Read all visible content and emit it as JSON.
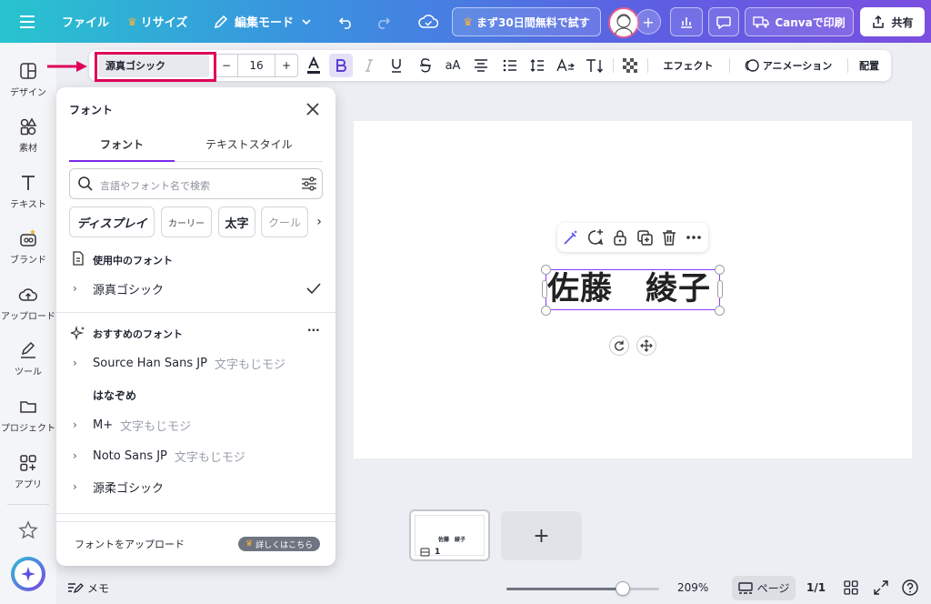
{
  "topbar": {
    "file_label": "ファイル",
    "resize_label": "リサイズ",
    "edit_mode_label": "編集モード",
    "trial_label": "まず30日間無料で試す",
    "print_label": "Canvaで印刷",
    "share_label": "共有"
  },
  "rail": {
    "items": [
      {
        "label": "デザイン",
        "icon": "layout-icon"
      },
      {
        "label": "素材",
        "icon": "shapes-icon"
      },
      {
        "label": "テキスト",
        "icon": "text-icon"
      },
      {
        "label": "ブランド",
        "icon": "brand-icon"
      },
      {
        "label": "アップロード",
        "icon": "cloud-upload-icon"
      },
      {
        "label": "ツール",
        "icon": "pen-icon"
      },
      {
        "label": "プロジェクト",
        "icon": "folder-icon"
      },
      {
        "label": "アプリ",
        "icon": "apps-icon"
      }
    ]
  },
  "toolbar": {
    "font_name": "源真ゴシック",
    "font_size": "16",
    "minus": "−",
    "plus": "+",
    "case_label": "aA",
    "effect_label": "エフェクト",
    "animation_label": "アニメーション",
    "position_label": "配置"
  },
  "panel": {
    "title": "フォント",
    "tab_font": "フォント",
    "tab_text_style": "テキストスタイル",
    "search_placeholder": "言語やフォント名で検索",
    "chips": [
      "ディスプレイ",
      "カーリー",
      "太字",
      "クール"
    ],
    "in_use_heading": "使用中のフォント",
    "in_use_font": "源真ゴシック",
    "recommended_heading": "おすすめのフォント",
    "more": "···",
    "fonts": [
      {
        "name": "Source Han Sans JP",
        "sample": "文字もじモジ"
      },
      {
        "name": "はなぞめ",
        "sample": ""
      },
      {
        "name": "M+",
        "sample": "文字もじモジ"
      },
      {
        "name": "Noto Sans JP",
        "sample": "文字もじモジ"
      },
      {
        "name": "源柔ゴシック",
        "sample": ""
      }
    ],
    "upload_label": "フォントをアップロード",
    "learn_more": "詳しくはこちら"
  },
  "canvas": {
    "text": "佐藤　綾子"
  },
  "pages": {
    "thumb_text": "佐藤　綾子",
    "thumb_number": "1",
    "add": "+"
  },
  "bottom": {
    "notes_label": "メモ",
    "zoom": "209%",
    "zoom_fraction": 0.76,
    "page_label": "ページ",
    "page_count": "1/1"
  },
  "colors": {
    "accent": "#7d2ae8",
    "highlight": "#e0005a"
  }
}
